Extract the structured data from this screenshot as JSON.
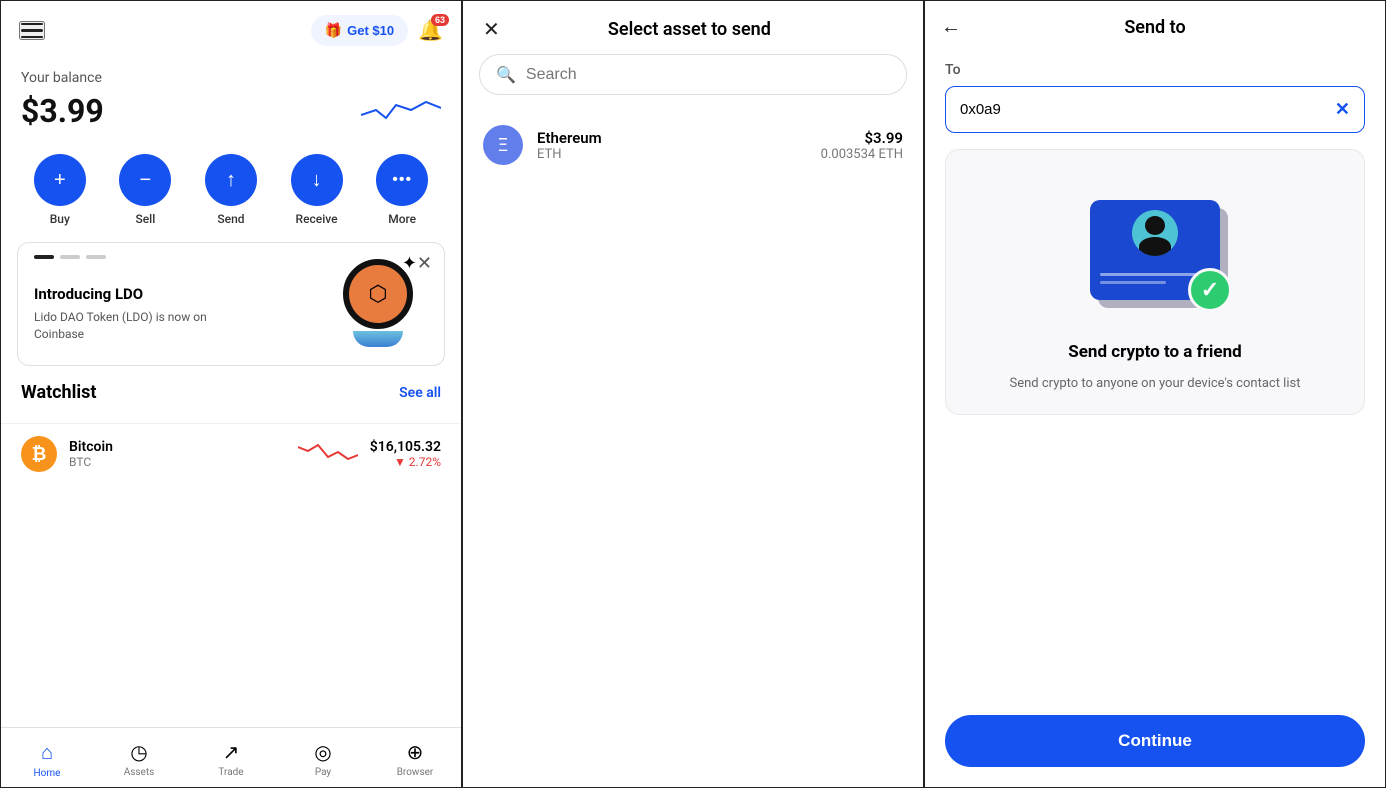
{
  "panel1": {
    "header": {
      "get_money_label": "Get $10",
      "notif_count": "63"
    },
    "balance": {
      "label": "Your balance",
      "amount": "$3.99"
    },
    "actions": [
      {
        "id": "buy",
        "label": "Buy",
        "icon": "+"
      },
      {
        "id": "sell",
        "label": "Sell",
        "icon": "−"
      },
      {
        "id": "send",
        "label": "Send",
        "icon": "↑"
      },
      {
        "id": "receive",
        "label": "Receive",
        "icon": "↓"
      },
      {
        "id": "more",
        "label": "More",
        "icon": "···"
      }
    ],
    "promo": {
      "title": "Introducing LDO",
      "description": "Lido DAO Token (LDO) is now on Coinbase"
    },
    "watchlist": {
      "title": "Watchlist",
      "see_all": "See all",
      "items": [
        {
          "name": "Bitcoin",
          "ticker": "BTC",
          "price": "$16,105.32",
          "change": "▼ 2.72%",
          "change_dir": "down"
        }
      ]
    },
    "bottom_nav": [
      {
        "id": "home",
        "label": "Home",
        "icon": "⌂",
        "active": true
      },
      {
        "id": "assets",
        "label": "Assets",
        "icon": "○"
      },
      {
        "id": "trade",
        "label": "Trade",
        "icon": "↗"
      },
      {
        "id": "pay",
        "label": "Pay",
        "icon": "◎"
      },
      {
        "id": "browser",
        "label": "Browser",
        "icon": "⊕"
      }
    ]
  },
  "panel2": {
    "title": "Select asset to send",
    "search_placeholder": "Search",
    "assets": [
      {
        "name": "Ethereum",
        "ticker": "ETH",
        "usd_value": "$3.99",
        "eth_value": "0.003534 ETH"
      }
    ]
  },
  "panel3": {
    "title": "Send to",
    "to_label": "To",
    "address_value": "0x0a9",
    "card": {
      "title": "Send crypto to a friend",
      "description": "Send crypto to anyone on your device's contact list"
    },
    "continue_label": "Continue"
  },
  "colors": {
    "brand_blue": "#1652f0",
    "btc_orange": "#f7931a",
    "eth_purple": "#627eea",
    "red": "#e53935",
    "green": "#2ecc71"
  }
}
